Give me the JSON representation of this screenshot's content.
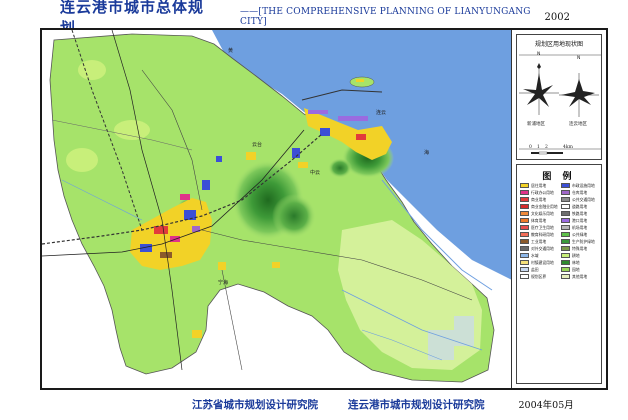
{
  "header": {
    "title_cn": "连云港市城市总体规划",
    "title_en": "——[THE COMPREHENSIVE PLANNING OF LIANYUNGANG CITY]",
    "year": "2002"
  },
  "inset": {
    "title": "规划区用地现状图",
    "rose_left_label": "新浦地区",
    "rose_right_label": "连云地区",
    "north_label": "N",
    "scale_ticks": [
      "0",
      "1",
      "2",
      "4km"
    ]
  },
  "map": {
    "sea_labels": [
      "黄",
      "海"
    ],
    "place_labels": [
      "云台",
      "宁海",
      "中云",
      "连云"
    ]
  },
  "legend": {
    "title": "图 例",
    "items": [
      {
        "label": "居住用地",
        "color": "#f2d227"
      },
      {
        "label": "市政设施用地",
        "color": "#3b4fd6"
      },
      {
        "label": "行政办公用地",
        "color": "#e0338a"
      },
      {
        "label": "仓库用地",
        "color": "#a067c8"
      },
      {
        "label": "商业用地",
        "color": "#e23b3b"
      },
      {
        "label": "公共交通用地",
        "color": "#8c8c8c"
      },
      {
        "label": "商业金融业用地",
        "color": "#d42a2a"
      },
      {
        "label": "道路用地",
        "color": "#ffffff"
      },
      {
        "label": "文化娱乐用地",
        "color": "#f08a3a"
      },
      {
        "label": "铁路用地",
        "color": "#6e6e6e"
      },
      {
        "label": "体育用地",
        "color": "#ef7a2a"
      },
      {
        "label": "港口用地",
        "color": "#9a6be0"
      },
      {
        "label": "医疗卫生用地",
        "color": "#e84e4e"
      },
      {
        "label": "机场用地",
        "color": "#b7b7b7"
      },
      {
        "label": "教育科研用地",
        "color": "#f36f5a"
      },
      {
        "label": "公共绿地",
        "color": "#5fc14a"
      },
      {
        "label": "工业用地",
        "color": "#8b5a2b"
      },
      {
        "label": "生产防护绿地",
        "color": "#3a9a3a"
      },
      {
        "label": "对外交通用地",
        "color": "#6a6a6a"
      },
      {
        "label": "特殊用地",
        "color": "#7a9a4a"
      },
      {
        "label": "水域",
        "color": "#8fb8e8"
      },
      {
        "label": "耕地",
        "color": "#c8ef7a"
      },
      {
        "label": "村镇建设用地",
        "color": "#f5e07a"
      },
      {
        "label": "林地",
        "color": "#2f8a2f"
      },
      {
        "label": "盐田",
        "color": "#c9d9f0"
      },
      {
        "label": "园地",
        "color": "#9ad65a"
      },
      {
        "label": "规划区界",
        "color": "#ffffff"
      },
      {
        "label": "其他用地",
        "color": "#e8f0c0"
      }
    ]
  },
  "footer": {
    "org1": "江苏省城市规划设计研究院",
    "org2": "连云港市城市规划设计研究院",
    "date": "2004年05月"
  }
}
